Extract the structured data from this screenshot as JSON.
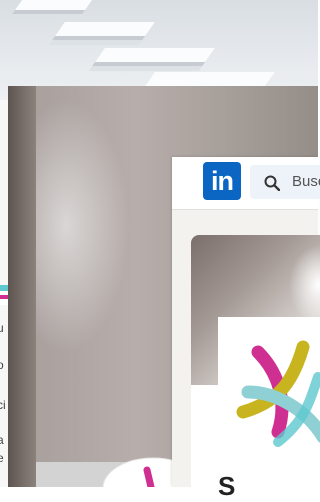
{
  "back_window": {
    "text_fragments": [
      "u",
      "o",
      "ci",
      "a",
      "e"
    ],
    "accent_colors": [
      "#5ec8cf",
      "#cf2f91"
    ]
  },
  "linkedin": {
    "logo_text": "in",
    "logo_icon": "linkedin-logo",
    "search": {
      "placeholder": "Busc",
      "icon": "search-icon"
    },
    "brand_color": "#0a66c2",
    "org_name_fragment": "S",
    "org_logo_colors": [
      "#c8b41e",
      "#8fd0d5",
      "#cf2f91",
      "#2a2a2a"
    ]
  }
}
